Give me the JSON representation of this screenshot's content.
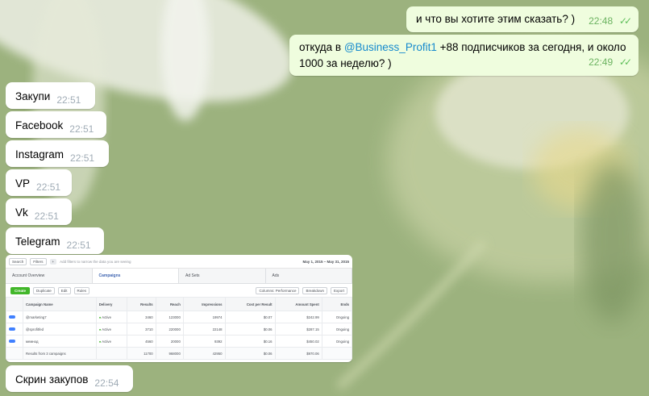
{
  "messages_out": [
    {
      "text": "и что вы хотите этим сказать? )",
      "time": "22:48"
    },
    {
      "text_before": "откуда в ",
      "mention": "@Business_Profit1",
      "text_after": " +88 подписчиков за сегодня, и около",
      "text_line2": "1000 за неделю? )",
      "time": "22:49"
    }
  ],
  "messages_in": [
    {
      "text": "Закупи",
      "time": "22:51"
    },
    {
      "text": "Facebook",
      "time": "22:51"
    },
    {
      "text": "Instagram",
      "time": "22:51"
    },
    {
      "text": "VP",
      "time": "22:51"
    },
    {
      "text": "Vk",
      "time": "22:51"
    },
    {
      "text": "Telegram",
      "time": "22:51"
    },
    {
      "text": "Скрин закупов",
      "time": "22:54"
    }
  ],
  "checkmarks": "✓✓",
  "screenshot": {
    "search": "Search",
    "filters": "Filters",
    "filter_hint": "Add filters to narrow the data you are seeing",
    "date_range": "May 1, 2015 – May 31, 2015",
    "tabs": [
      "Account Overview",
      "Campaigns",
      "Ad Sets",
      "Ads"
    ],
    "create": "Create",
    "duplicate": "Duplicate",
    "edit": "Edit",
    "rules": "Rules",
    "columns": "Columns: Performance",
    "breakdown": "Breakdown",
    "export": "Export",
    "headers": [
      "Campaign Name",
      "Delivery",
      "Results",
      "Reach",
      "Impressions",
      "Cost per Result",
      "Amount Spent",
      "Ends"
    ],
    "rows": [
      {
        "name": "@marketing7",
        "delivery": "Active",
        "results": "3460",
        "reach": "123000",
        "impressions": "19974",
        "cost": "$0.07",
        "spent": "$242.99",
        "ends": "Ongoing"
      },
      {
        "name": "@sprofitfed",
        "delivery": "Active",
        "results": "3710",
        "reach": "220000",
        "impressions": "22148",
        "cost": "$0.06",
        "spent": "$287.15",
        "ends": "Ongoing"
      },
      {
        "name": "мемнод",
        "delivery": "Active",
        "results": "4560",
        "reach": "20000",
        "impressions": "9392",
        "cost": "$0.16",
        "spent": "$450.02",
        "ends": "Ongoing"
      }
    ],
    "totals": {
      "name": "Results from 3 campaigns",
      "results": "11700",
      "reach": "968000",
      "impressions": "42950",
      "cost": "$0.06",
      "spent": "$970.06"
    }
  }
}
